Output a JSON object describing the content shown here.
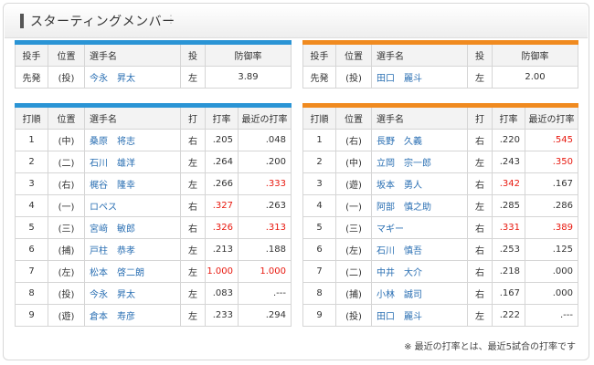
{
  "title": "スターティングメンバー",
  "pitch_headers": [
    "投手",
    "位置",
    "選手名",
    "投",
    "防御率"
  ],
  "home_pitcher": {
    "role": "先発",
    "pos": "(投)",
    "name": "今永　昇太",
    "hand": "左",
    "era": "3.89"
  },
  "away_pitcher": {
    "role": "先発",
    "pos": "(投)",
    "name": "田口　麗斗",
    "hand": "左",
    "era": "2.00"
  },
  "lineup_headers": [
    "打順",
    "位置",
    "選手名",
    "打",
    "打率",
    "最近の打率"
  ],
  "home_lineup": [
    {
      "order": "1",
      "pos": "(中)",
      "name": "桑原　将志",
      "hand": "右",
      "avg": ".205",
      "recent": ".048",
      "avg_red": false,
      "recent_red": false
    },
    {
      "order": "2",
      "pos": "(二)",
      "name": "石川　雄洋",
      "hand": "左",
      "avg": ".264",
      "recent": ".200",
      "avg_red": false,
      "recent_red": false
    },
    {
      "order": "3",
      "pos": "(右)",
      "name": "梶谷　隆幸",
      "hand": "左",
      "avg": ".266",
      "recent": ".333",
      "avg_red": false,
      "recent_red": true
    },
    {
      "order": "4",
      "pos": "(一)",
      "name": "ロペス",
      "hand": "右",
      "avg": ".327",
      "recent": ".263",
      "avg_red": true,
      "recent_red": false
    },
    {
      "order": "5",
      "pos": "(三)",
      "name": "宮﨑　敏郎",
      "hand": "右",
      "avg": ".326",
      "recent": ".313",
      "avg_red": true,
      "recent_red": true
    },
    {
      "order": "6",
      "pos": "(捕)",
      "name": "戸柱　恭孝",
      "hand": "左",
      "avg": ".213",
      "recent": ".188",
      "avg_red": false,
      "recent_red": false
    },
    {
      "order": "7",
      "pos": "(左)",
      "name": "松本　啓二朗",
      "hand": "左",
      "avg": "1.000",
      "recent": "1.000",
      "avg_red": true,
      "recent_red": true
    },
    {
      "order": "8",
      "pos": "(投)",
      "name": "今永　昇太",
      "hand": "左",
      "avg": ".083",
      "recent": ".---",
      "avg_red": false,
      "recent_red": false
    },
    {
      "order": "9",
      "pos": "(遊)",
      "name": "倉本　寿彦",
      "hand": "左",
      "avg": ".233",
      "recent": ".294",
      "avg_red": false,
      "recent_red": false
    }
  ],
  "away_lineup": [
    {
      "order": "1",
      "pos": "(右)",
      "name": "長野　久義",
      "hand": "右",
      "avg": ".220",
      "recent": ".545",
      "avg_red": false,
      "recent_red": true
    },
    {
      "order": "2",
      "pos": "(中)",
      "name": "立岡　宗一郎",
      "hand": "左",
      "avg": ".243",
      "recent": ".350",
      "avg_red": false,
      "recent_red": true
    },
    {
      "order": "3",
      "pos": "(遊)",
      "name": "坂本　勇人",
      "hand": "右",
      "avg": ".342",
      "recent": ".167",
      "avg_red": true,
      "recent_red": false
    },
    {
      "order": "4",
      "pos": "(一)",
      "name": "阿部　慎之助",
      "hand": "左",
      "avg": ".285",
      "recent": ".286",
      "avg_red": false,
      "recent_red": false
    },
    {
      "order": "5",
      "pos": "(三)",
      "name": "マギー",
      "hand": "右",
      "avg": ".331",
      "recent": ".389",
      "avg_red": true,
      "recent_red": true
    },
    {
      "order": "6",
      "pos": "(左)",
      "name": "石川　慎吾",
      "hand": "右",
      "avg": ".253",
      "recent": ".125",
      "avg_red": false,
      "recent_red": false
    },
    {
      "order": "7",
      "pos": "(二)",
      "name": "中井　大介",
      "hand": "右",
      "avg": ".218",
      "recent": ".000",
      "avg_red": false,
      "recent_red": false
    },
    {
      "order": "8",
      "pos": "(捕)",
      "name": "小林　誠司",
      "hand": "右",
      "avg": ".167",
      "recent": ".000",
      "avg_red": false,
      "recent_red": false
    },
    {
      "order": "9",
      "pos": "(投)",
      "name": "田口　麗斗",
      "hand": "左",
      "avg": ".222",
      "recent": ".---",
      "avg_red": false,
      "recent_red": false
    }
  ],
  "note": "※ 最近の打率とは、最近5試合の打率です",
  "colors": {
    "home_accent": "#2a94d5",
    "away_accent": "#f08a1f",
    "name_blue": "#2a6fb3",
    "highlight_red": "#e8190f"
  }
}
